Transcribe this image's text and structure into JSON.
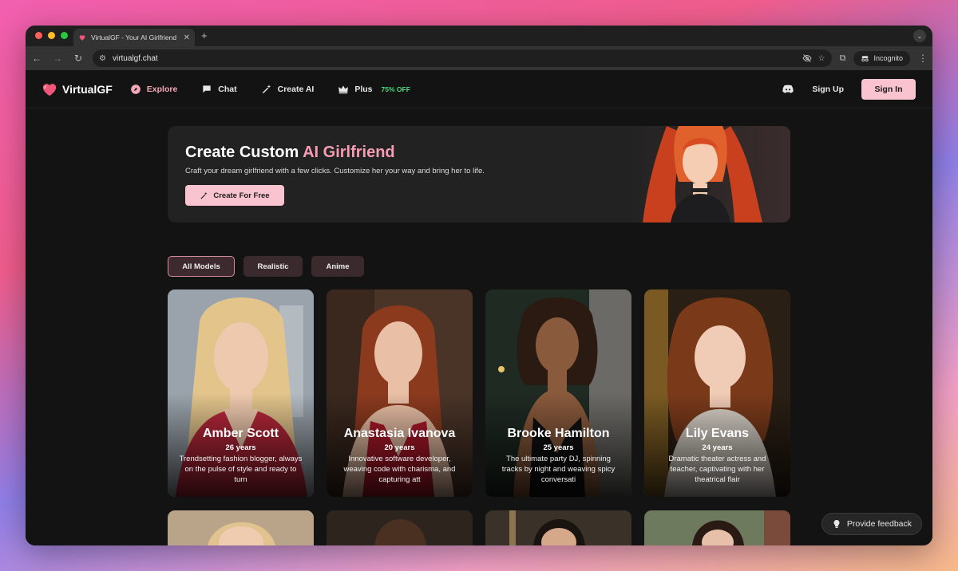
{
  "browser": {
    "tab_title": "VirtualGF - Your AI Girlfriend",
    "url": "virtualgf.chat",
    "incognito_label": "Incognito"
  },
  "site": {
    "brand": "VirtualGF",
    "nav": [
      {
        "label": "Explore",
        "icon": "compass-icon"
      },
      {
        "label": "Chat",
        "icon": "chat-bubble-icon"
      },
      {
        "label": "Create AI",
        "icon": "magic-wand-icon"
      },
      {
        "label": "Plus",
        "icon": "crown-icon"
      }
    ],
    "plus_discount": "75% OFF",
    "sign_up": "Sign Up",
    "sign_in": "Sign In",
    "accent": "#f69db4"
  },
  "hero": {
    "title_main": "Create Custom ",
    "title_accent": "AI Girlfriend",
    "subtitle": "Craft your dream girlfriend with a few clicks. Customize her your way and bring her to life.",
    "button": "Create For Free"
  },
  "filters": [
    "All Models",
    "Realistic",
    "Anime"
  ],
  "cards": [
    {
      "name": "Amber Scott",
      "age": "26 years",
      "description": "Trendsetting fashion blogger, always on the pulse of style and ready to turn"
    },
    {
      "name": "Anastasia Ivanova",
      "age": "20 years",
      "description": "Innovative software developer, weaving code with charisma, and capturing att"
    },
    {
      "name": "Brooke Hamilton",
      "age": "25 years",
      "description": "The ultimate party DJ, spinning tracks by night and weaving spicy conversati"
    },
    {
      "name": "Lily Evans",
      "age": "24 years",
      "description": "Dramatic theater actress and teacher, captivating with her theatrical flair"
    }
  ],
  "feedback": "Provide feedback"
}
